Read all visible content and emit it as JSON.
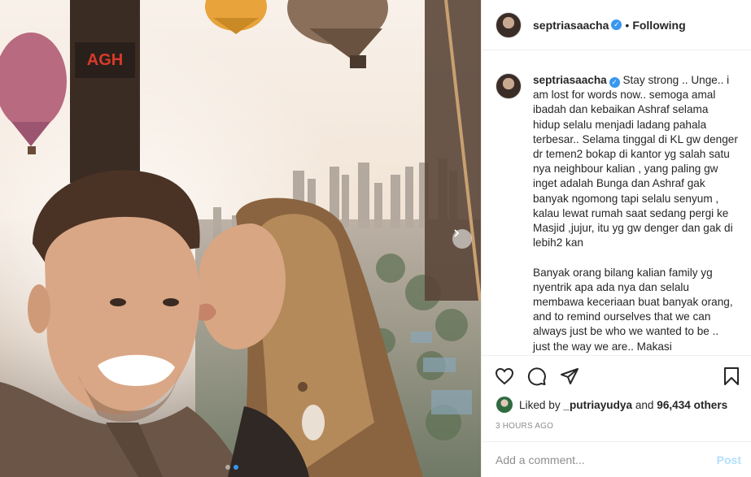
{
  "photo": {
    "balloon_sign": "AGH",
    "carousel": {
      "dots": 2,
      "active_index": 1
    }
  },
  "header": {
    "username": "septriasaacha",
    "verified": "✓",
    "separator": "•",
    "follow_status": "Following"
  },
  "caption": {
    "username": "septriasaacha",
    "verified": "✓",
    "text": "Stay strong .. Unge.. i am lost for words now.. semoga amal ibadah dan kebaikan Ashraf selama hidup selalu menjadi ladang pahala terbesar.. Selama tinggal di KL gw denger dr temen2 bokap di kantor yg salah satu nya neighbour kalian , yang paling gw inget adalah Bunga dan Ashraf gak banyak ngomong tapi selalu senyum , kalau lewat rumah saat sedang pergi ke Masjid ,jujur, itu yg gw denger dan gak di lebih2 kan\n\nBanyak orang bilang kalian family yg nyentrik apa ada nya dan selalu membawa keceriaan buat banyak orang, and to remind ourselves that we can always just be who we wanted to be .. just the way we are.. Makasi"
  },
  "actions": {
    "like_icon": "heart-icon",
    "comment_icon": "comment-icon",
    "share_icon": "share-icon",
    "save_icon": "bookmark-icon"
  },
  "likes": {
    "prefix": "Liked by",
    "liker": "_putriayudya",
    "connector": "and",
    "others": "96,434 others"
  },
  "timestamp": "3 HOURS AGO",
  "comment_box": {
    "placeholder": "Add a comment...",
    "post_label": "Post"
  },
  "colors": {
    "accent": "#3897f0",
    "post_disabled": "#b2dffc",
    "muted": "#8e8e8e"
  }
}
